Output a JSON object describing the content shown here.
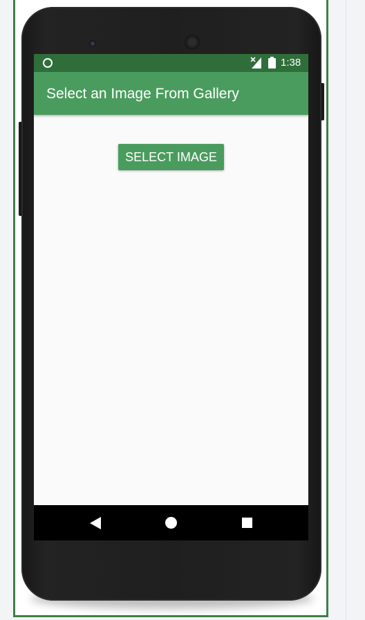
{
  "status_bar": {
    "time": "1:38",
    "icons": [
      "notification-circle-icon",
      "signal-off-icon",
      "battery-icon"
    ],
    "color": "#2f6e3a"
  },
  "app_bar": {
    "title": "Select an Image From Gallery",
    "color": "#4a9c5e"
  },
  "main": {
    "select_button_label": "SELECT IMAGE"
  },
  "nav_bar": {
    "icons": [
      "back-icon",
      "home-icon",
      "recents-icon"
    ]
  }
}
